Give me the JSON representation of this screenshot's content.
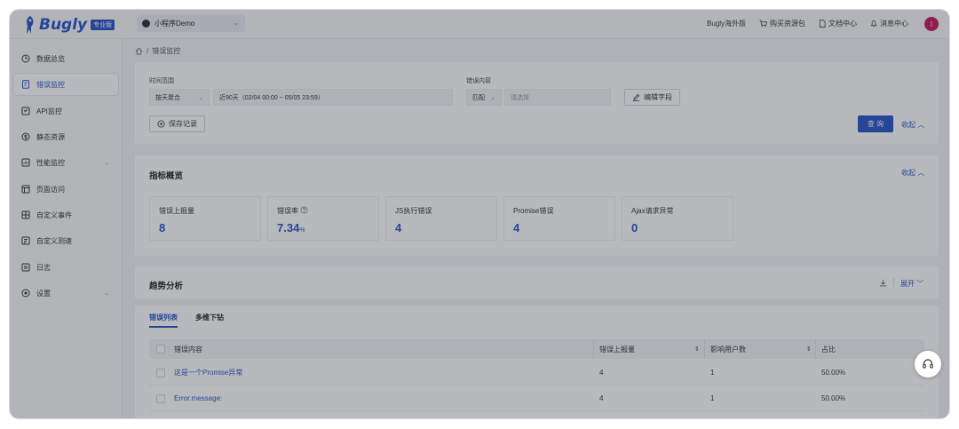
{
  "brand": {
    "name": "Bugly",
    "badge": "专业版"
  },
  "app_select": {
    "value": "小程序Demo"
  },
  "topnav": {
    "overseas": "Bugly海外版",
    "buy": "购买资源包",
    "docs": "文档中心",
    "messages": "消息中心",
    "avatar_letter": "I"
  },
  "sidebar": {
    "items": [
      {
        "label": "数据总览",
        "icon": "clock-icon"
      },
      {
        "label": "错误监控",
        "icon": "error-icon"
      },
      {
        "label": "API监控",
        "icon": "api-icon"
      },
      {
        "label": "静态资源",
        "icon": "resource-icon"
      },
      {
        "label": "性能监控",
        "icon": "performance-icon"
      },
      {
        "label": "页面访问",
        "icon": "page-icon"
      },
      {
        "label": "自定义事件",
        "icon": "event-icon"
      },
      {
        "label": "自定义测速",
        "icon": "speed-icon"
      },
      {
        "label": "日志",
        "icon": "log-icon"
      },
      {
        "label": "设置",
        "icon": "settings-icon"
      }
    ]
  },
  "breadcrumb": {
    "sep": "/",
    "current": "错误监控"
  },
  "filter": {
    "time_label": "时间范围",
    "agg": "按天聚合",
    "range": "近90天（02/04 00:00 ~ 05/05 23:59）",
    "content_label": "错误内容",
    "match": "匹配",
    "placeholder": "请选择",
    "edit_fields": "编辑字段",
    "save_record": "保存记录",
    "query": "查 询",
    "collapse": "收起"
  },
  "metrics": {
    "title": "指标概览",
    "collapse": "收起",
    "items": [
      {
        "label": "错误上报量",
        "value": "8",
        "unit": ""
      },
      {
        "label": "错误率",
        "value": "7.34",
        "unit": "%"
      },
      {
        "label": "JS执行错误",
        "value": "4",
        "unit": ""
      },
      {
        "label": "Promise错误",
        "value": "4",
        "unit": ""
      },
      {
        "label": "Ajax请求异常",
        "value": "0",
        "unit": ""
      }
    ]
  },
  "trend": {
    "title": "趋势分析",
    "expand": "展开"
  },
  "list": {
    "tabs": [
      "错误列表",
      "多维下钻"
    ],
    "headers": {
      "content": "错误内容",
      "reports": "错误上报量",
      "users": "影响用户数",
      "ratio": "占比"
    },
    "rows": [
      {
        "content": "这是一个Promise异常",
        "reports": "4",
        "users": "1",
        "ratio": "50.00%"
      },
      {
        "content": "Error.message:",
        "reports": "4",
        "users": "1",
        "ratio": "50.00%"
      }
    ]
  },
  "colors": {
    "accent": "#2553c8",
    "badge_bg": "#2553c8",
    "avatar": "#c2185b"
  }
}
